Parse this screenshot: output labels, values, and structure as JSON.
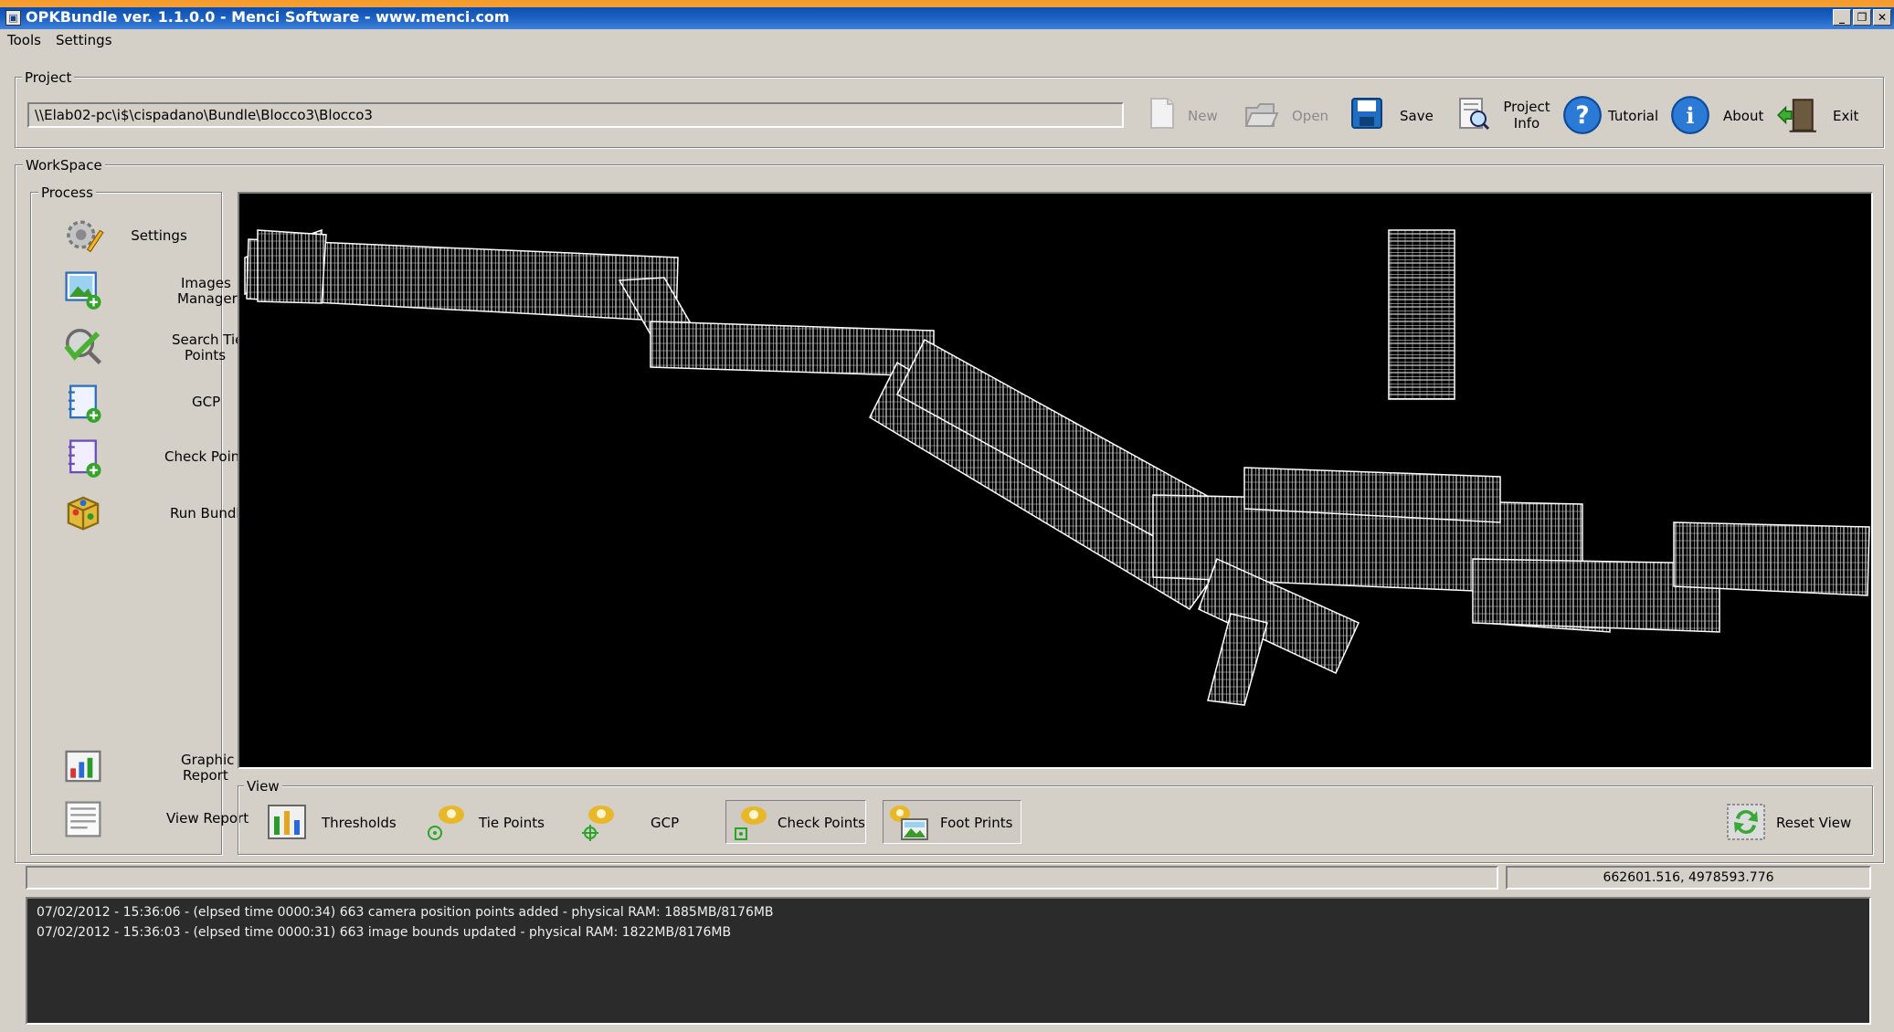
{
  "window": {
    "title": "OPKBundle ver. 1.1.0.0 - Menci Software - www.menci.com",
    "controls": [
      "_",
      "❐",
      "✕"
    ]
  },
  "menu": {
    "items": [
      "Tools",
      "Settings"
    ]
  },
  "project": {
    "group_label": "Project",
    "path": "\\\\Elab02-pc\\i$\\cispadano\\Bundle\\Blocco3\\Blocco3",
    "toolbar": {
      "new": "New",
      "open": "Open",
      "save": "Save",
      "project_info_1": "Project",
      "project_info_2": "Info",
      "tutorial": "Tutorial",
      "about": "About",
      "exit": "Exit"
    }
  },
  "workspace": {
    "group_label": "WorkSpace",
    "process": {
      "group_label": "Process",
      "settings": "Settings",
      "images_manager_1": "Images",
      "images_manager_2": "Manager",
      "search_tie_points_1": "Search Tie",
      "search_tie_points_2": "Points",
      "gcp": "GCP",
      "check_points": "Check Points",
      "run_bundle": "Run Bundle",
      "graphic_report_1": "Graphic",
      "graphic_report_2": "Report",
      "view_report": "View Report"
    },
    "view": {
      "group_label": "View",
      "thresholds": "Thresholds",
      "tie_points": "Tie Points",
      "gcp": "GCP",
      "check_points": "Check Points",
      "foot_prints": "Foot Prints",
      "reset_view": "Reset View"
    },
    "canvas": {
      "background": "#000000",
      "footprint_color": "#ffffff"
    }
  },
  "status": {
    "coordinates": "662601.516, 4978593.776",
    "log": [
      "07/02/2012 - 15:36:06 - (elpsed time 0000:34) 663 camera position points added - physical RAM: 1885MB/8176MB",
      "07/02/2012 - 15:36:03 - (elpsed time 0000:31) 663 image bounds updated - physical RAM: 1822MB/8176MB"
    ]
  }
}
